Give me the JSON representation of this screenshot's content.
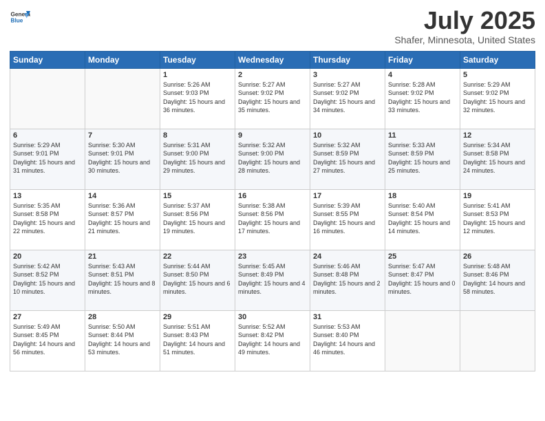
{
  "header": {
    "logo": {
      "general": "General",
      "blue": "Blue"
    },
    "title": "July 2025",
    "location": "Shafer, Minnesota, United States"
  },
  "weekdays": [
    "Sunday",
    "Monday",
    "Tuesday",
    "Wednesday",
    "Thursday",
    "Friday",
    "Saturday"
  ],
  "weeks": [
    [
      {
        "day": "",
        "sunrise": "",
        "sunset": "",
        "daylight": ""
      },
      {
        "day": "",
        "sunrise": "",
        "sunset": "",
        "daylight": ""
      },
      {
        "day": "1",
        "sunrise": "Sunrise: 5:26 AM",
        "sunset": "Sunset: 9:03 PM",
        "daylight": "Daylight: 15 hours and 36 minutes."
      },
      {
        "day": "2",
        "sunrise": "Sunrise: 5:27 AM",
        "sunset": "Sunset: 9:02 PM",
        "daylight": "Daylight: 15 hours and 35 minutes."
      },
      {
        "day": "3",
        "sunrise": "Sunrise: 5:27 AM",
        "sunset": "Sunset: 9:02 PM",
        "daylight": "Daylight: 15 hours and 34 minutes."
      },
      {
        "day": "4",
        "sunrise": "Sunrise: 5:28 AM",
        "sunset": "Sunset: 9:02 PM",
        "daylight": "Daylight: 15 hours and 33 minutes."
      },
      {
        "day": "5",
        "sunrise": "Sunrise: 5:29 AM",
        "sunset": "Sunset: 9:02 PM",
        "daylight": "Daylight: 15 hours and 32 minutes."
      }
    ],
    [
      {
        "day": "6",
        "sunrise": "Sunrise: 5:29 AM",
        "sunset": "Sunset: 9:01 PM",
        "daylight": "Daylight: 15 hours and 31 minutes."
      },
      {
        "day": "7",
        "sunrise": "Sunrise: 5:30 AM",
        "sunset": "Sunset: 9:01 PM",
        "daylight": "Daylight: 15 hours and 30 minutes."
      },
      {
        "day": "8",
        "sunrise": "Sunrise: 5:31 AM",
        "sunset": "Sunset: 9:00 PM",
        "daylight": "Daylight: 15 hours and 29 minutes."
      },
      {
        "day": "9",
        "sunrise": "Sunrise: 5:32 AM",
        "sunset": "Sunset: 9:00 PM",
        "daylight": "Daylight: 15 hours and 28 minutes."
      },
      {
        "day": "10",
        "sunrise": "Sunrise: 5:32 AM",
        "sunset": "Sunset: 8:59 PM",
        "daylight": "Daylight: 15 hours and 27 minutes."
      },
      {
        "day": "11",
        "sunrise": "Sunrise: 5:33 AM",
        "sunset": "Sunset: 8:59 PM",
        "daylight": "Daylight: 15 hours and 25 minutes."
      },
      {
        "day": "12",
        "sunrise": "Sunrise: 5:34 AM",
        "sunset": "Sunset: 8:58 PM",
        "daylight": "Daylight: 15 hours and 24 minutes."
      }
    ],
    [
      {
        "day": "13",
        "sunrise": "Sunrise: 5:35 AM",
        "sunset": "Sunset: 8:58 PM",
        "daylight": "Daylight: 15 hours and 22 minutes."
      },
      {
        "day": "14",
        "sunrise": "Sunrise: 5:36 AM",
        "sunset": "Sunset: 8:57 PM",
        "daylight": "Daylight: 15 hours and 21 minutes."
      },
      {
        "day": "15",
        "sunrise": "Sunrise: 5:37 AM",
        "sunset": "Sunset: 8:56 PM",
        "daylight": "Daylight: 15 hours and 19 minutes."
      },
      {
        "day": "16",
        "sunrise": "Sunrise: 5:38 AM",
        "sunset": "Sunset: 8:56 PM",
        "daylight": "Daylight: 15 hours and 17 minutes."
      },
      {
        "day": "17",
        "sunrise": "Sunrise: 5:39 AM",
        "sunset": "Sunset: 8:55 PM",
        "daylight": "Daylight: 15 hours and 16 minutes."
      },
      {
        "day": "18",
        "sunrise": "Sunrise: 5:40 AM",
        "sunset": "Sunset: 8:54 PM",
        "daylight": "Daylight: 15 hours and 14 minutes."
      },
      {
        "day": "19",
        "sunrise": "Sunrise: 5:41 AM",
        "sunset": "Sunset: 8:53 PM",
        "daylight": "Daylight: 15 hours and 12 minutes."
      }
    ],
    [
      {
        "day": "20",
        "sunrise": "Sunrise: 5:42 AM",
        "sunset": "Sunset: 8:52 PM",
        "daylight": "Daylight: 15 hours and 10 minutes."
      },
      {
        "day": "21",
        "sunrise": "Sunrise: 5:43 AM",
        "sunset": "Sunset: 8:51 PM",
        "daylight": "Daylight: 15 hours and 8 minutes."
      },
      {
        "day": "22",
        "sunrise": "Sunrise: 5:44 AM",
        "sunset": "Sunset: 8:50 PM",
        "daylight": "Daylight: 15 hours and 6 minutes."
      },
      {
        "day": "23",
        "sunrise": "Sunrise: 5:45 AM",
        "sunset": "Sunset: 8:49 PM",
        "daylight": "Daylight: 15 hours and 4 minutes."
      },
      {
        "day": "24",
        "sunrise": "Sunrise: 5:46 AM",
        "sunset": "Sunset: 8:48 PM",
        "daylight": "Daylight: 15 hours and 2 minutes."
      },
      {
        "day": "25",
        "sunrise": "Sunrise: 5:47 AM",
        "sunset": "Sunset: 8:47 PM",
        "daylight": "Daylight: 15 hours and 0 minutes."
      },
      {
        "day": "26",
        "sunrise": "Sunrise: 5:48 AM",
        "sunset": "Sunset: 8:46 PM",
        "daylight": "Daylight: 14 hours and 58 minutes."
      }
    ],
    [
      {
        "day": "27",
        "sunrise": "Sunrise: 5:49 AM",
        "sunset": "Sunset: 8:45 PM",
        "daylight": "Daylight: 14 hours and 56 minutes."
      },
      {
        "day": "28",
        "sunrise": "Sunrise: 5:50 AM",
        "sunset": "Sunset: 8:44 PM",
        "daylight": "Daylight: 14 hours and 53 minutes."
      },
      {
        "day": "29",
        "sunrise": "Sunrise: 5:51 AM",
        "sunset": "Sunset: 8:43 PM",
        "daylight": "Daylight: 14 hours and 51 minutes."
      },
      {
        "day": "30",
        "sunrise": "Sunrise: 5:52 AM",
        "sunset": "Sunset: 8:42 PM",
        "daylight": "Daylight: 14 hours and 49 minutes."
      },
      {
        "day": "31",
        "sunrise": "Sunrise: 5:53 AM",
        "sunset": "Sunset: 8:40 PM",
        "daylight": "Daylight: 14 hours and 46 minutes."
      },
      {
        "day": "",
        "sunrise": "",
        "sunset": "",
        "daylight": ""
      },
      {
        "day": "",
        "sunrise": "",
        "sunset": "",
        "daylight": ""
      }
    ]
  ]
}
